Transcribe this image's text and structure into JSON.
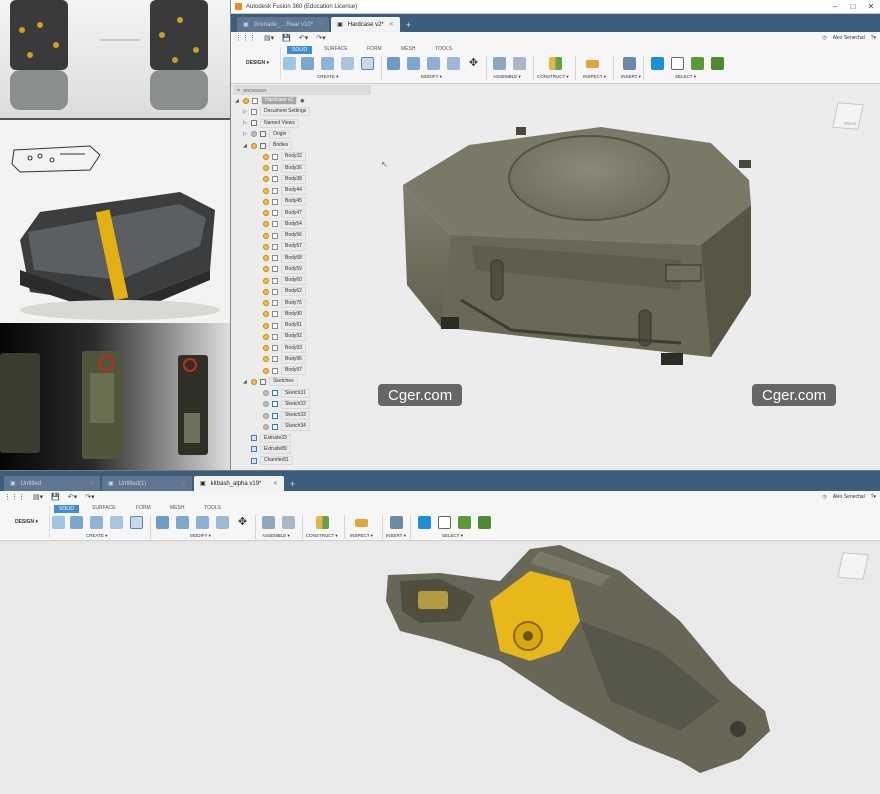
{
  "top_window": {
    "title": "Autodesk Fusion 360 (Education License)",
    "tabs": [
      {
        "label": "Grenade_…Rear v10*",
        "active": false
      },
      {
        "label": "Hardcase v2*",
        "active": true
      }
    ],
    "user": "Alex Senechal",
    "workspace": "DESIGN",
    "ribbon_tabs": [
      "SOLID",
      "SURFACE",
      "FORM",
      "MESH",
      "TOOLS"
    ],
    "groups": [
      "CREATE",
      "MODIFY",
      "ASSEMBLE",
      "CONSTRUCT",
      "INSPECT",
      "INSERT",
      "SELECT"
    ],
    "browser": {
      "header": "BROWSER",
      "root": "Hardcase v2",
      "items": [
        {
          "label": "Document Settings",
          "type": "settings",
          "indent": 1,
          "caret": "▷"
        },
        {
          "label": "Named Views",
          "type": "folder",
          "indent": 1,
          "caret": "▷"
        },
        {
          "label": "Origin",
          "type": "folder",
          "indent": 1,
          "caret": "▷",
          "bulb": true
        },
        {
          "label": "Bodies",
          "type": "folder",
          "indent": 1,
          "caret": "◢",
          "bulb": true
        },
        {
          "label": "Body32",
          "type": "body",
          "indent": 2
        },
        {
          "label": "Body36",
          "type": "body",
          "indent": 2
        },
        {
          "label": "Body38",
          "type": "body",
          "indent": 2
        },
        {
          "label": "Body44",
          "type": "body",
          "indent": 2
        },
        {
          "label": "Body45",
          "type": "body",
          "indent": 2
        },
        {
          "label": "Body47",
          "type": "body",
          "indent": 2
        },
        {
          "label": "Body54",
          "type": "body",
          "indent": 2
        },
        {
          "label": "Body56",
          "type": "body",
          "indent": 2
        },
        {
          "label": "Body57",
          "type": "body",
          "indent": 2
        },
        {
          "label": "Body58",
          "type": "body",
          "indent": 2
        },
        {
          "label": "Body59",
          "type": "body",
          "indent": 2
        },
        {
          "label": "Body60",
          "type": "body",
          "indent": 2
        },
        {
          "label": "Body62",
          "type": "body",
          "indent": 2
        },
        {
          "label": "Body75",
          "type": "body",
          "indent": 2
        },
        {
          "label": "Body90",
          "type": "body",
          "indent": 2
        },
        {
          "label": "Body91",
          "type": "body",
          "indent": 2
        },
        {
          "label": "Body92",
          "type": "body",
          "indent": 2
        },
        {
          "label": "Body93",
          "type": "body",
          "indent": 2
        },
        {
          "label": "Body96",
          "type": "body",
          "indent": 2
        },
        {
          "label": "Body97",
          "type": "body",
          "indent": 2
        },
        {
          "label": "Sketches",
          "type": "folder",
          "indent": 1,
          "caret": "◢",
          "bulb": true
        },
        {
          "label": "Sketch31",
          "type": "sketch",
          "indent": 2
        },
        {
          "label": "Sketch32",
          "type": "sketch",
          "indent": 2
        },
        {
          "label": "Sketch33",
          "type": "sketch",
          "indent": 2
        },
        {
          "label": "Sketch34",
          "type": "sketch",
          "indent": 2
        },
        {
          "label": "Extrude33",
          "type": "feature",
          "indent": 1
        },
        {
          "label": "Extrude89",
          "type": "feature",
          "indent": 1
        },
        {
          "label": "Chamfer81",
          "type": "feature",
          "indent": 1
        }
      ]
    },
    "viewcube_label": "RIGHT"
  },
  "watermarks": [
    "Cger.com",
    "Cger.com"
  ],
  "bottom_window": {
    "tabs": [
      {
        "label": "Untitled",
        "active": false
      },
      {
        "label": "Untitled(1)",
        "active": false
      },
      {
        "label": "kitbash_alpha v19*",
        "active": true
      }
    ],
    "user": "Alex Senechal",
    "workspace": "DESIGN",
    "ribbon_tabs": [
      "SOLID",
      "SURFACE",
      "FORM",
      "MESH",
      "TOOLS"
    ],
    "groups": [
      "CREATE",
      "MODIFY",
      "ASSEMBLE",
      "CONSTRUCT",
      "INSPECT",
      "INSERT",
      "SELECT"
    ]
  },
  "colors": {
    "tab_bar": "#3c5d7b",
    "accent_blue": "#3d8fd0",
    "model_body": "#6b6a5c",
    "highlight_yellow": "#e8b81b"
  }
}
